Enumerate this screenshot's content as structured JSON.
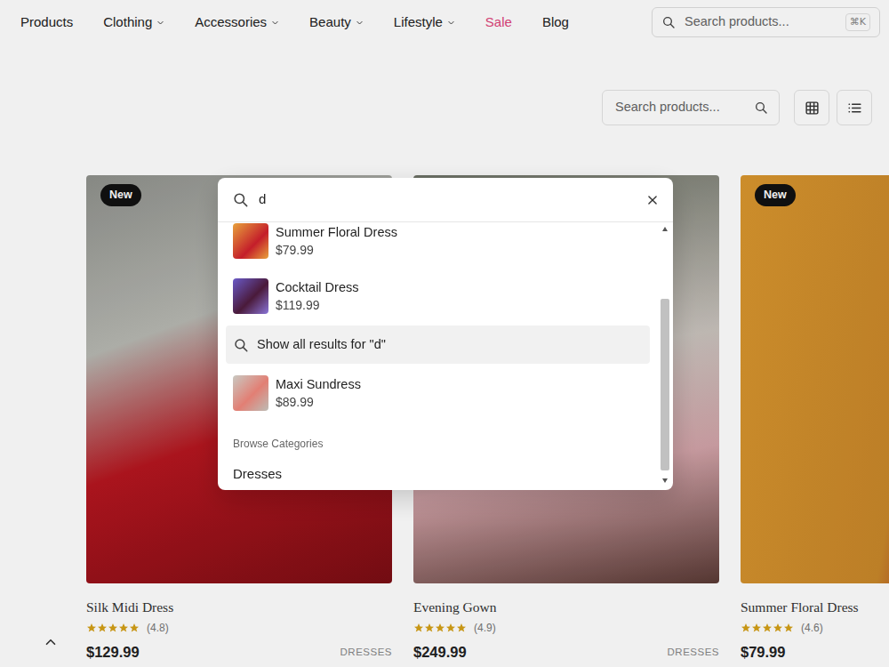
{
  "nav": {
    "items": [
      {
        "label": "Products",
        "kind": "link",
        "dropdown": false
      },
      {
        "label": "Clothing",
        "kind": "link",
        "dropdown": true
      },
      {
        "label": "Accessories",
        "kind": "link",
        "dropdown": true
      },
      {
        "label": "Beauty",
        "kind": "link",
        "dropdown": true
      },
      {
        "label": "Lifestyle",
        "kind": "link",
        "dropdown": true
      },
      {
        "label": "Sale",
        "kind": "sale",
        "dropdown": false
      },
      {
        "label": "Blog",
        "kind": "link",
        "dropdown": false
      }
    ],
    "search": {
      "placeholder": "Search products...",
      "shortcut": "⌘K"
    }
  },
  "toolbar": {
    "search": {
      "placeholder": "Search products..."
    }
  },
  "products": [
    {
      "badge": "New",
      "title": "Silk Midi Dress",
      "stars": 5,
      "rating": "(4.8)",
      "price": "$129.99",
      "category": "DRESSES"
    },
    {
      "badge": null,
      "title": "Evening Gown",
      "stars": 5,
      "rating": "(4.9)",
      "price": "$249.99",
      "category": "DRESSES"
    },
    {
      "badge": "New",
      "title": "Summer Floral Dress",
      "stars": 5,
      "rating": "(4.6)",
      "price": "$79.99",
      "category": null
    }
  ],
  "search_modal": {
    "query": "d",
    "results": [
      {
        "kind": "product",
        "name": "Summer Floral Dress",
        "price": "$79.99",
        "selected": false
      },
      {
        "kind": "product",
        "name": "Cocktail Dress",
        "price": "$119.99",
        "selected": false
      },
      {
        "kind": "show_all",
        "label": "Show all results for \"d\"",
        "selected": true
      },
      {
        "kind": "product",
        "name": "Maxi Sundress",
        "price": "$89.99",
        "selected": false
      }
    ],
    "categories_heading": "Browse Categories",
    "categories": [
      {
        "label": "Dresses"
      }
    ]
  }
}
